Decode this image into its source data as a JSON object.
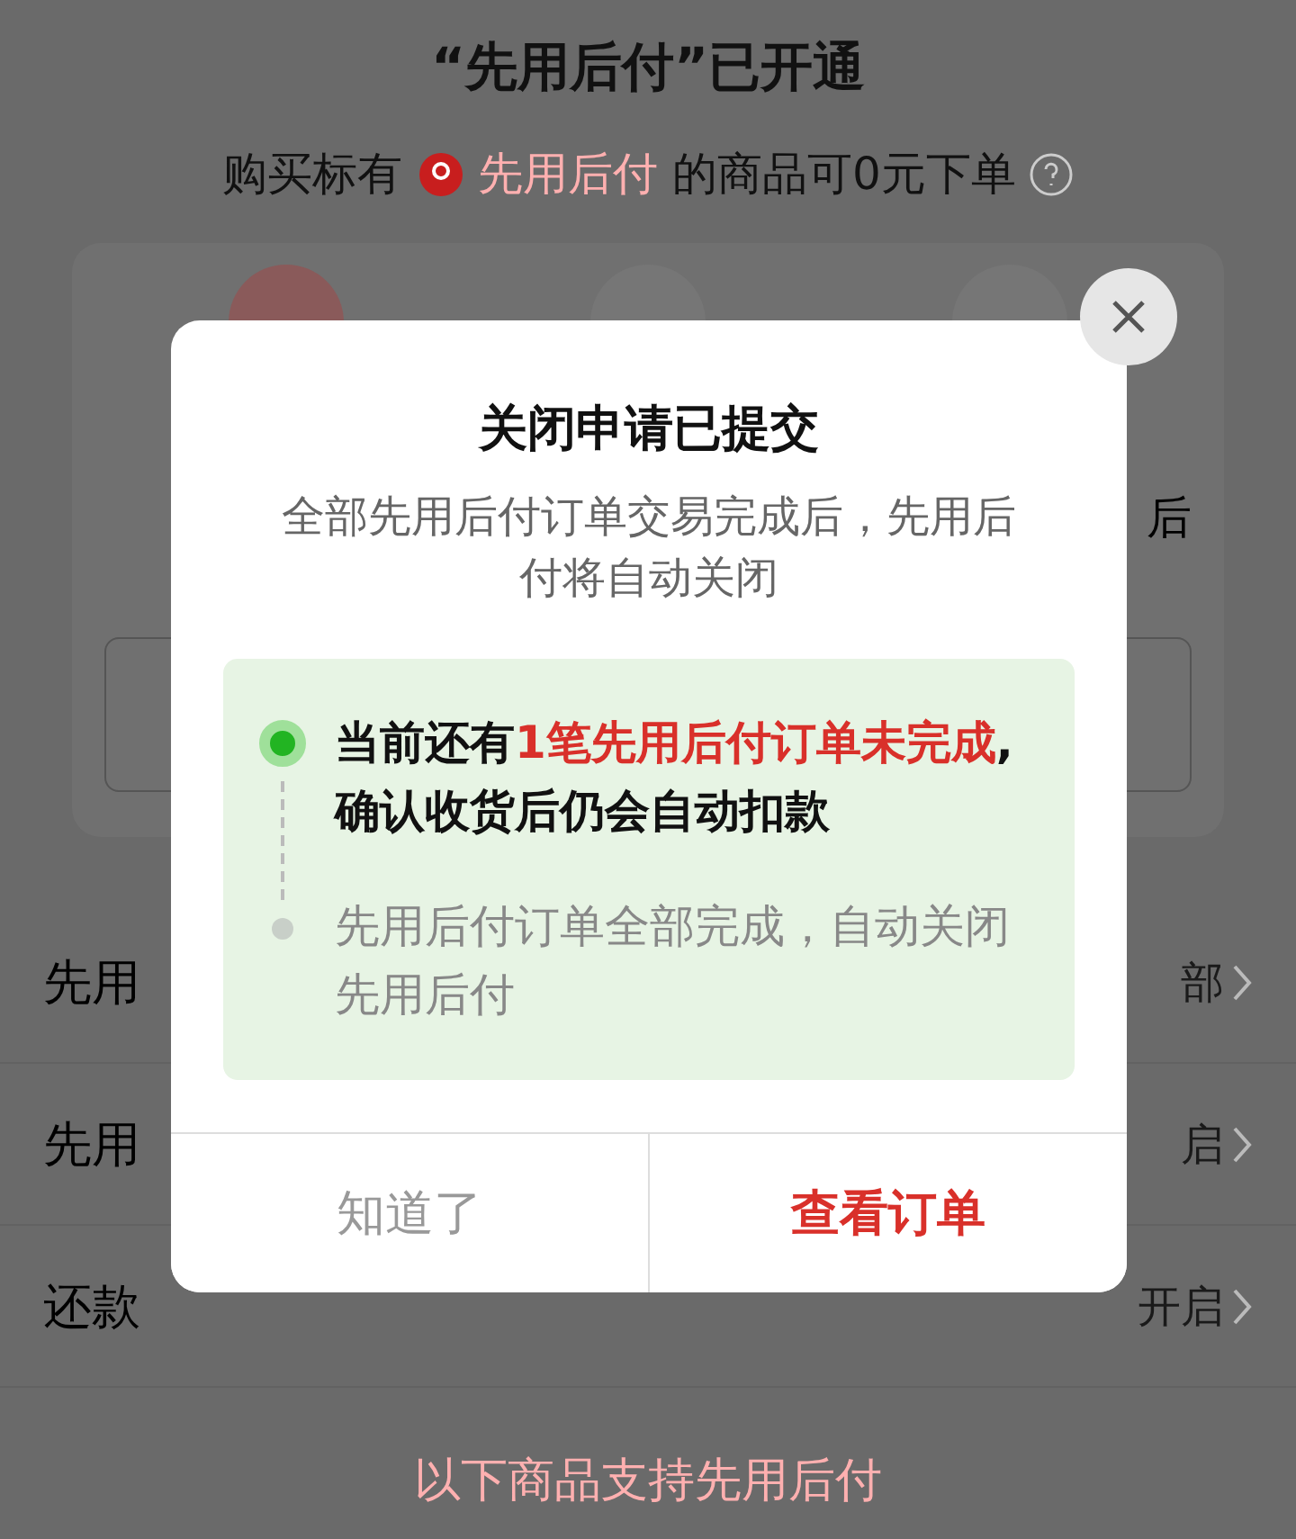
{
  "background": {
    "title": "“先用后付”已开通",
    "subtitle": {
      "before": "购买标有",
      "badge": "先用后付",
      "after": "的商品可0元下单"
    },
    "card_fragment": "后",
    "settings": [
      {
        "label": "先用",
        "value": "部"
      },
      {
        "label": "先用",
        "value": "启"
      },
      {
        "label": "还款",
        "value": "开启"
      }
    ],
    "footer": "以下商品支持先用后付"
  },
  "dialog": {
    "title": "关闭申请已提交",
    "description": "全部先用后付订单交易完成后，先用后付将自动关闭",
    "steps": [
      {
        "active": true,
        "parts": [
          {
            "text": "当前还有",
            "highlight": false
          },
          {
            "text": "1笔先用后付订单未完成",
            "highlight": true
          },
          {
            "text": ",确认收货后仍会自动扣款",
            "highlight": false
          }
        ]
      },
      {
        "active": false,
        "parts": [
          {
            "text": "先用后付订单全部完成，自动关闭先用后付",
            "highlight": false
          }
        ]
      }
    ],
    "buttons": [
      {
        "label": "知道了",
        "kind": "secondary"
      },
      {
        "label": "查看订单",
        "kind": "primary"
      }
    ]
  }
}
